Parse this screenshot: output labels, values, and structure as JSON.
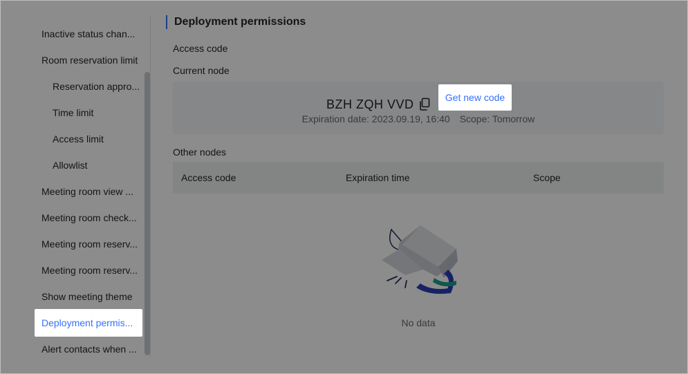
{
  "sidebar": {
    "items": [
      {
        "label": "Inactive status chan...",
        "level": 1
      },
      {
        "label": "Room reservation limit",
        "level": 1
      },
      {
        "label": "Reservation appro...",
        "level": 2
      },
      {
        "label": "Time limit",
        "level": 2
      },
      {
        "label": "Access limit",
        "level": 2
      },
      {
        "label": "Allowlist",
        "level": 2
      },
      {
        "label": "Meeting room view ...",
        "level": 1
      },
      {
        "label": "Meeting room check...",
        "level": 1
      },
      {
        "label": "Meeting room reserv...",
        "level": 1
      },
      {
        "label": "Meeting room reserv...",
        "level": 1
      },
      {
        "label": "Show meeting theme",
        "level": 1
      },
      {
        "label": "Deployment permis...",
        "level": 1,
        "active": true
      },
      {
        "label": "Alert contacts when ...",
        "level": 1
      }
    ]
  },
  "main": {
    "title": "Deployment permissions",
    "access_code_label": "Access code",
    "current_node_label": "Current node",
    "current_code": "BZH ZQH VVD",
    "get_new_code": "Get new code",
    "expiration": "Expiration date: 2023.09.19, 16:40",
    "scope": "Scope:  Tomorrow",
    "other_nodes_label": "Other nodes",
    "table": {
      "columns": [
        "Access code",
        "Expiration time",
        "Scope"
      ],
      "rows": []
    },
    "empty_text": "No data"
  },
  "colors": {
    "accent": "#3370ff",
    "overlay": "rgba(0,0,0,0.45)"
  },
  "icons": {
    "copy": "copy-icon",
    "empty": "empty-box-illustration"
  }
}
